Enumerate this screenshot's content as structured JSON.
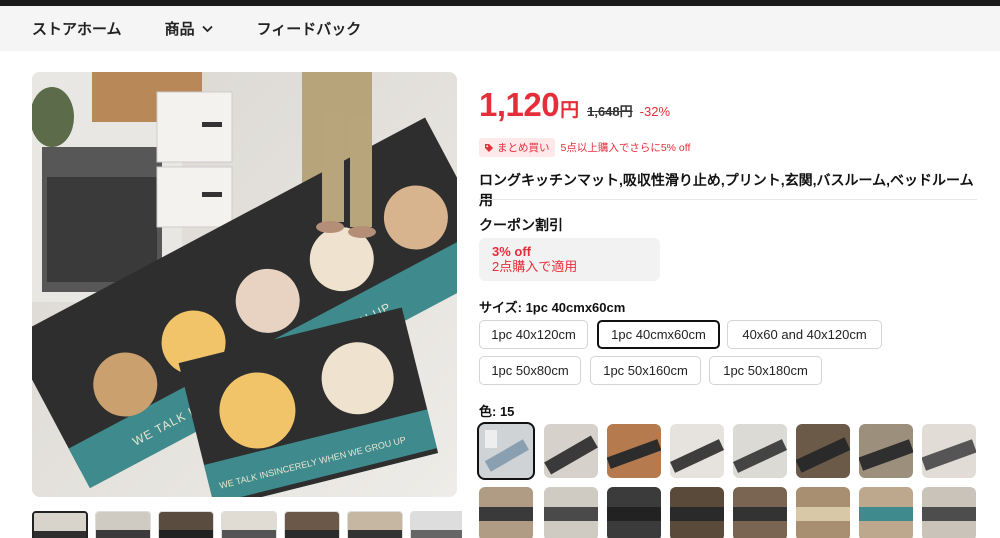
{
  "nav": {
    "home": "ストアホーム",
    "products": "商品",
    "feedback": "フィードバック"
  },
  "product": {
    "price": "1,120",
    "price_unit": "円",
    "original_price": "1,648円",
    "discount": "-32%",
    "bundle_badge": "まとめ買い",
    "bundle_text": "5点以上購入でさらに5% off",
    "title": "ロングキッチンマット,吸収性滑り止め,プリント,玄関,バスルーム,ベッドルーム用",
    "main_image_text_1": "WE TALK INSINCERELY WHEN WE GROU UP",
    "main_image_text_2": "WE TALK INSINCERELY WHEN WE GROU UP"
  },
  "coupon": {
    "heading": "クーポン割引",
    "amount": "3% off",
    "condition": "2点購入で適用"
  },
  "size": {
    "heading_label": "サイズ: ",
    "selected": "1pc 40cmx60cm",
    "options": [
      "1pc 40x120cm",
      "1pc 40cmx60cm",
      "40x60 and 40x120cm",
      "1pc 50x80cm",
      "1pc 50x160cm",
      "1pc 50x180cm"
    ]
  },
  "color": {
    "heading_label": "色: ",
    "count": "15"
  },
  "colors": {
    "price_red": "#e62e3a",
    "nav_bg": "#f5f5f5",
    "teal": "#3f8a8c"
  }
}
